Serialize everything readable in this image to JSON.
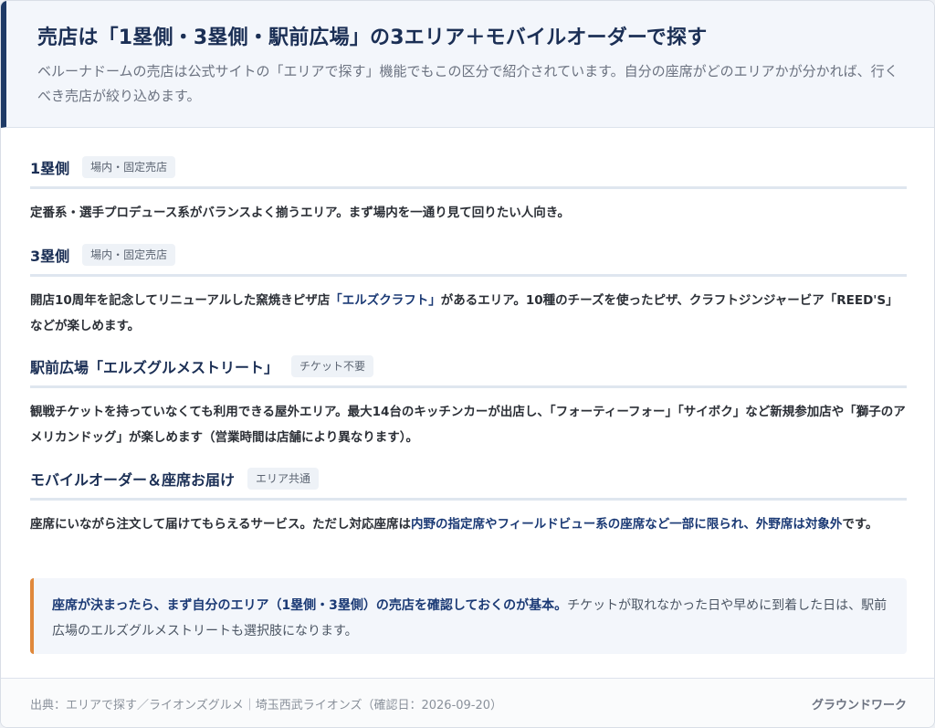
{
  "header": {
    "title": "売店は「1塁側・3塁側・駅前広場」の3エリア＋モバイルオーダーで探す",
    "lead": "ベルーナドームの売店は公式サイトの「エリアで探す」機能でもこの区分で紹介されています。自分の座席がどのエリアかが分かれば、行くべき売店が絞り込めます。"
  },
  "sections": [
    {
      "title": "1塁側",
      "tag": "場内・固定売店",
      "text": "定番系・選手プロデュース系がバランスよく揃うエリア。まず場内を一通り見て回りたい人向き。"
    },
    {
      "title": "3塁側",
      "tag": "場内・固定売店",
      "text_pre": "開店10周年を記念してリニューアルした窯焼きピザ店",
      "text_hl": "「エルズクラフト」",
      "text_post": "があるエリア。10種のチーズを使ったピザ、クラフトジンジャービア「REED'S」などが楽しめます。"
    },
    {
      "title": "駅前広場「エルズグルメストリート」",
      "tag": "チケット不要",
      "text": "観戦チケットを持っていなくても利用できる屋外エリア。最大14台のキッチンカーが出店し、「フォーティーフォー」「サイボク」など新規参加店や「獅子のアメリカンドッグ」が楽しめます（営業時間は店舗により異なります）。"
    },
    {
      "title": "モバイルオーダー＆座席お届け",
      "tag": "エリア共通",
      "text_pre": "座席にいながら注文して届けてもらえるサービス。ただし対応座席は",
      "text_hl": "内野の指定席やフィールドビュー系の座席など一部に限られ、外野席は対象外",
      "text_post": "です。"
    }
  ],
  "callout": {
    "strong": "座席が決まったら、まず自分のエリア（1塁側・3塁側）の売店を確認しておくのが基本。",
    "rest": "チケットが取れなかった日や早めに到着した日は、駅前広場のエルズグルメストリートも選択肢になります。"
  },
  "footer": {
    "source": "出典：エリアで探す／ライオンズグルメ｜埼玉西武ライオンズ（確認日：2026-09-20）",
    "brand": "グラウンドワーク"
  }
}
